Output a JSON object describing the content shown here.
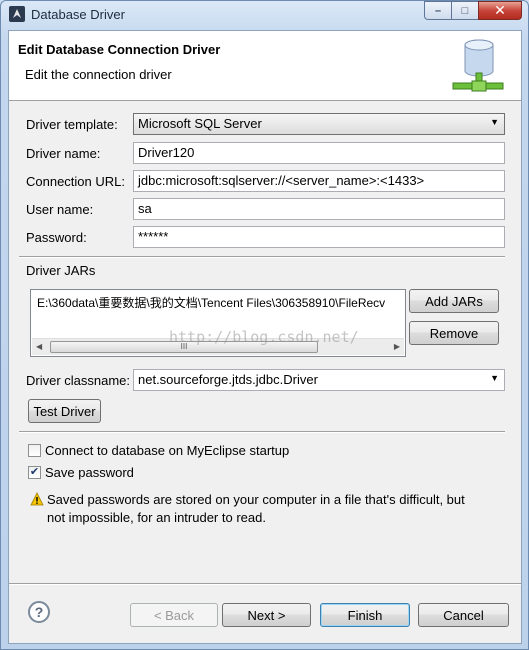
{
  "window": {
    "title": "Database Driver",
    "controls": {
      "minimize": "–",
      "maximize": "□",
      "close": "✕"
    }
  },
  "header": {
    "title": "Edit Database Connection Driver",
    "subtitle": "Edit the connection driver",
    "icon": "database-driver-icon"
  },
  "form": {
    "template_label": "Driver template:",
    "template_value": "Microsoft SQL Server",
    "name_label": "Driver name:",
    "name_value": "Driver120",
    "url_label": "Connection URL:",
    "url_value": "jdbc:microsoft:sqlserver://<server_name>:<1433>",
    "user_label": "User name:",
    "user_value": "sa",
    "password_label": "Password:",
    "password_value": "******"
  },
  "jars": {
    "label": "Driver JARs",
    "items": [
      "E:\\360data\\重要数据\\我的文档\\Tencent Files\\306358910\\FileRecv"
    ],
    "add_label": "Add JARs",
    "remove_label": "Remove",
    "scroll_thumb": "III"
  },
  "watermark": "http://blog.csdn.net/",
  "classname": {
    "label": "Driver classname:",
    "value": "net.sourceforge.jtds.jdbc.Driver"
  },
  "test_label": "Test Driver",
  "options": {
    "connect_label": "Connect to database on MyEclipse startup",
    "connect_checked": false,
    "save_label": "Save password",
    "save_checked": true
  },
  "warning": {
    "line1": "Saved passwords are stored on your computer in a file that's difficult, but",
    "line2": "not impossible, for an intruder to read."
  },
  "footer": {
    "help": "?",
    "back_label": "< Back",
    "next_label": "Next >",
    "finish_label": "Finish",
    "cancel_label": "Cancel"
  },
  "colors": {
    "accent": "#3c7fb1",
    "title_close": "#c8453a",
    "window_frame": "#bcd2eb"
  }
}
